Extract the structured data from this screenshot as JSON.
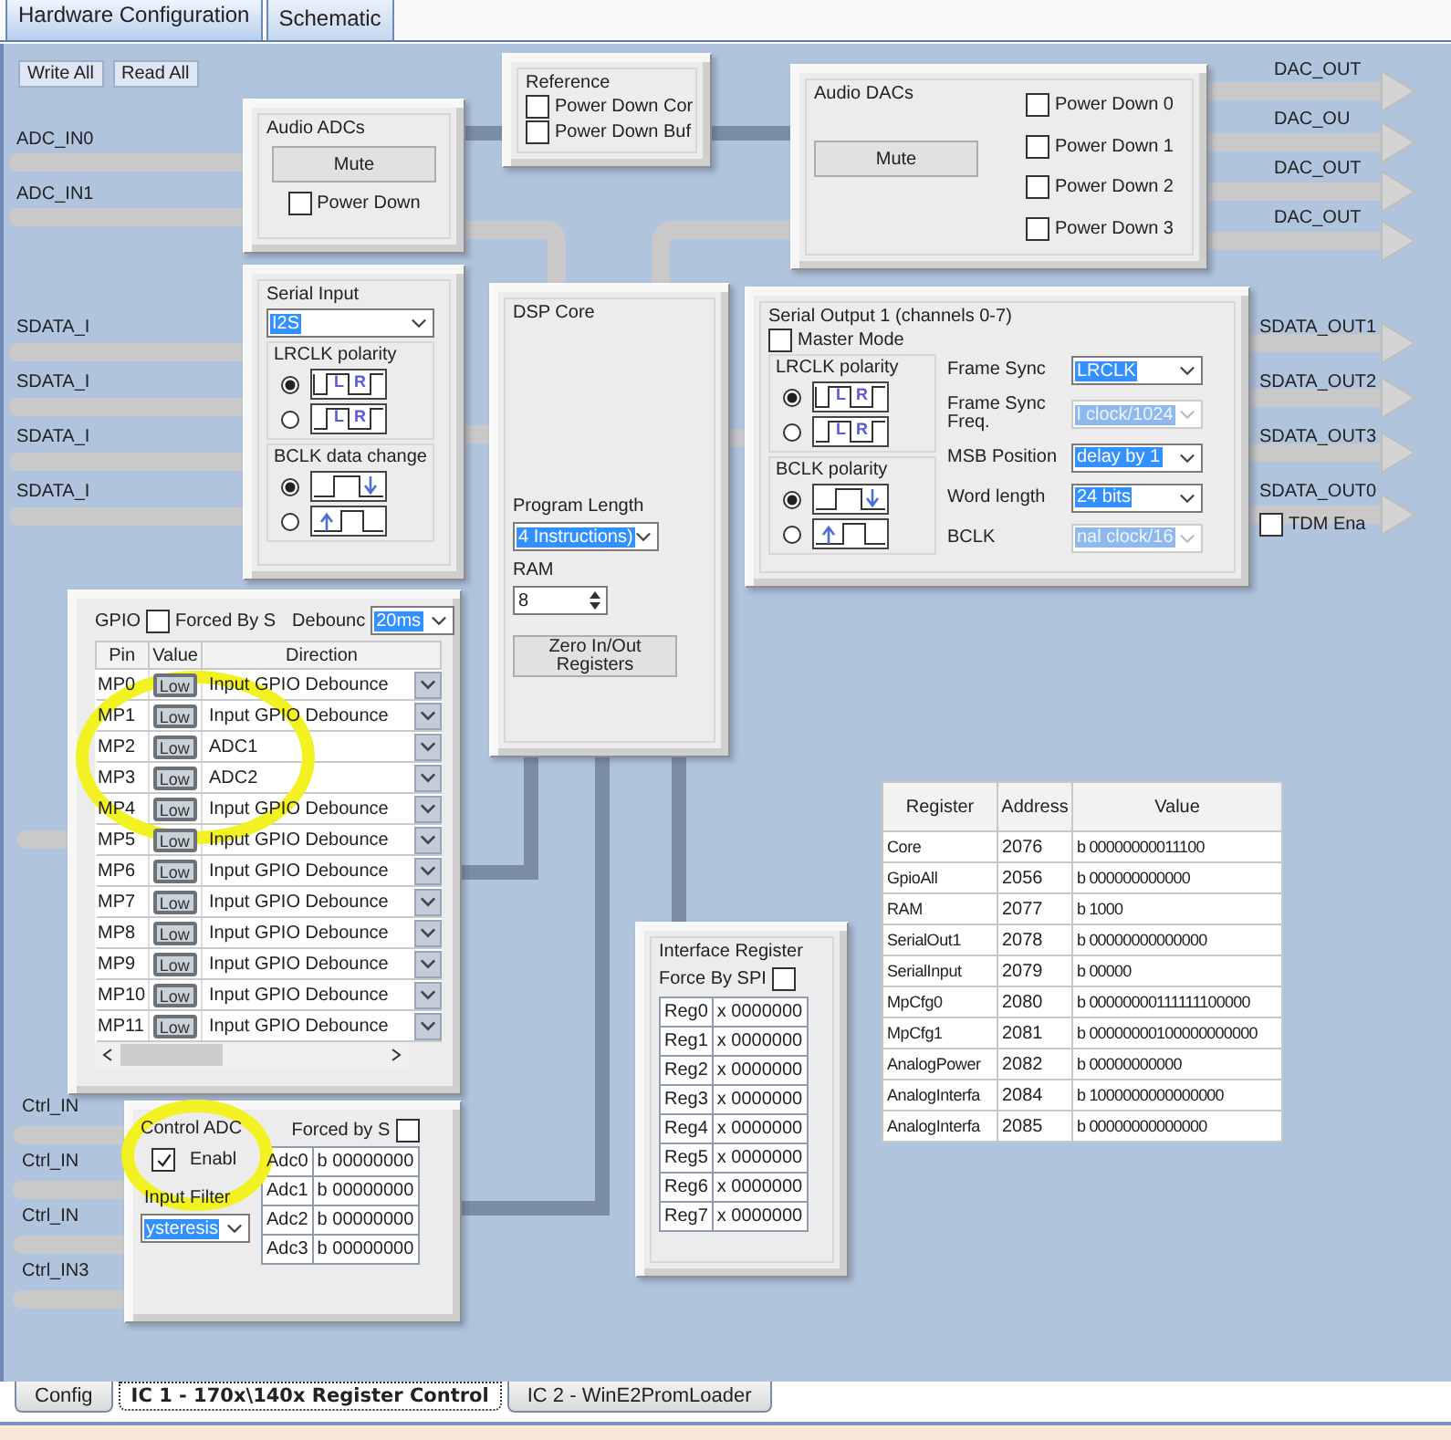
{
  "top_tabs": [
    {
      "label": "Hardware Configuration",
      "selected": true
    },
    {
      "label": "Schematic",
      "selected": false
    }
  ],
  "toolbar_buttons": [
    "Write All",
    "Read All"
  ],
  "adc_inputs": [
    "ADC_IN0",
    "ADC_IN1"
  ],
  "sdata_inputs": [
    "SDATA_I",
    "SDATA_I",
    "SDATA_I",
    "SDATA_I"
  ],
  "audio_adcs": {
    "title": "Audio ADCs",
    "mute": "Mute",
    "power_down": {
      "label": "Power Down",
      "checked": false
    }
  },
  "reference": {
    "title": "Reference",
    "options": [
      {
        "label": "Power Down Cor",
        "checked": false
      },
      {
        "label": "Power Down Buf",
        "checked": false
      }
    ]
  },
  "audio_dacs": {
    "title": "Audio DACs",
    "mute": "Mute",
    "options": [
      {
        "label": "Power Down 0",
        "checked": false
      },
      {
        "label": "Power Down 1",
        "checked": false
      },
      {
        "label": "Power Down 2",
        "checked": false
      },
      {
        "label": "Power Down 3",
        "checked": false
      }
    ]
  },
  "dac_outputs": [
    "DAC_OUT",
    "DAC_OU",
    "DAC_OUT",
    "DAC_OUT"
  ],
  "serial_input": {
    "title": "Serial Input",
    "format": "I2S",
    "lrclk": {
      "title": "LRCLK polarity",
      "options": [
        {
          "selected": true,
          "kind": "lr",
          "marks": [
            "L",
            "R"
          ]
        },
        {
          "selected": false,
          "kind": "lr-inverted",
          "marks": [
            "L",
            "R"
          ]
        }
      ]
    },
    "bclk": {
      "title": "BCLK data change",
      "options": [
        {
          "selected": true,
          "kind": "falling"
        },
        {
          "selected": false,
          "kind": "rising"
        }
      ]
    }
  },
  "dsp_core": {
    "title": "DSP Core",
    "program_length_label": "Program Length",
    "program_length": "4 Instructions)",
    "ram_label": "RAM",
    "ram_value": "8",
    "zero_button": "Zero In/Out Registers"
  },
  "serial_output": {
    "title": "Serial Output 1 (channels 0-7)",
    "master_mode": {
      "label": "Master Mode",
      "checked": false
    },
    "lrclk": {
      "title": "LRCLK polarity",
      "options": [
        {
          "selected": true,
          "kind": "lr",
          "marks": [
            "L",
            "R"
          ]
        },
        {
          "selected": false,
          "kind": "lr-inverted",
          "marks": [
            "L",
            "R"
          ]
        }
      ]
    },
    "bclk": {
      "title": "BCLK polarity",
      "options": [
        {
          "selected": true,
          "kind": "falling"
        },
        {
          "selected": false,
          "kind": "rising"
        }
      ]
    },
    "fields": [
      {
        "label": "Frame Sync",
        "value": "LRCLK",
        "disabled": false
      },
      {
        "label": "Frame Sync Freq.",
        "value": "l clock/1024",
        "disabled": true
      },
      {
        "label": "MSB Position",
        "value": "delay by 1",
        "disabled": false
      },
      {
        "label": "Word length",
        "value": "24 bits",
        "disabled": false
      },
      {
        "label": "BCLK",
        "value": "nal clock/16",
        "disabled": true
      }
    ]
  },
  "sdata_outputs": [
    "SDATA_OUT1",
    "SDATA_OUT2",
    "SDATA_OUT3",
    "SDATA_OUT0"
  ],
  "tdm": {
    "label": "TDM Ena",
    "checked": false
  },
  "gpio": {
    "title": "GPIO",
    "forced": {
      "label": "Forced By S",
      "checked": false
    },
    "debounce_label": "Debounc",
    "debounce": "20ms",
    "columns": [
      "Pin",
      "Value",
      "Direction"
    ],
    "rows": [
      {
        "pin": "MP0",
        "value": "Low",
        "direction": "Input  GPIO Debounce"
      },
      {
        "pin": "MP1",
        "value": "Low",
        "direction": "Input  GPIO Debounce"
      },
      {
        "pin": "MP2",
        "value": "Low",
        "direction": "ADC1"
      },
      {
        "pin": "MP3",
        "value": "Low",
        "direction": "ADC2"
      },
      {
        "pin": "MP4",
        "value": "Low",
        "direction": "Input  GPIO Debounce"
      },
      {
        "pin": "MP5",
        "value": "Low",
        "direction": "Input  GPIO Debounce"
      },
      {
        "pin": "MP6",
        "value": "Low",
        "direction": "Input  GPIO Debounce"
      },
      {
        "pin": "MP7",
        "value": "Low",
        "direction": "Input  GPIO Debounce"
      },
      {
        "pin": "MP8",
        "value": "Low",
        "direction": "Input  GPIO Debounce"
      },
      {
        "pin": "MP9",
        "value": "Low",
        "direction": "Input  GPIO Debounce"
      },
      {
        "pin": "MP10",
        "value": "Low",
        "direction": "Input  GPIO Debounce"
      },
      {
        "pin": "MP11",
        "value": "Low",
        "direction": "Input  GPIO Debounce"
      }
    ]
  },
  "interface_register": {
    "title": "Interface Register",
    "force": {
      "label": "Force By SPI",
      "checked": false
    },
    "rows": [
      {
        "name": "Reg0",
        "value": "x 0000000"
      },
      {
        "name": "Reg1",
        "value": "x 0000000"
      },
      {
        "name": "Reg2",
        "value": "x 0000000"
      },
      {
        "name": "Reg3",
        "value": "x 0000000"
      },
      {
        "name": "Reg4",
        "value": "x 0000000"
      },
      {
        "name": "Reg5",
        "value": "x 0000000"
      },
      {
        "name": "Reg6",
        "value": "x 0000000"
      },
      {
        "name": "Reg7",
        "value": "x 0000000"
      }
    ]
  },
  "register_table": {
    "columns": [
      "Register",
      "Address",
      "Value"
    ],
    "rows": [
      {
        "register": "Core",
        "address": "2076",
        "value": "b 00000000011100"
      },
      {
        "register": "GpioAll",
        "address": "2056",
        "value": "b 000000000000"
      },
      {
        "register": "RAM",
        "address": "2077",
        "value": "b 1000"
      },
      {
        "register": "SerialOut1",
        "address": "2078",
        "value": "b 00000000000000"
      },
      {
        "register": "SerialInput",
        "address": "2079",
        "value": "b 00000"
      },
      {
        "register": "MpCfg0",
        "address": "2080",
        "value": "b 00000000111111100000"
      },
      {
        "register": "MpCfg1",
        "address": "2081",
        "value": "b 00000000100000000000"
      },
      {
        "register": "AnalogPower",
        "address": "2082",
        "value": "b 00000000000"
      },
      {
        "register": "AnalogInterfa",
        "address": "2084",
        "value": "b 1000000000000000"
      },
      {
        "register": "AnalogInterfa",
        "address": "2085",
        "value": "b 00000000000000"
      }
    ]
  },
  "ctrl_inputs": [
    "Ctrl_IN",
    "Ctrl_IN",
    "Ctrl_IN",
    "Ctrl_IN3"
  ],
  "control_adc": {
    "title": "Control ADC",
    "enable": {
      "label": "Enabl",
      "checked": true
    },
    "forced": {
      "label": "Forced by S",
      "checked": false
    },
    "filter_label": "Input Filter",
    "filter": "ysteresis",
    "rows": [
      {
        "name": "Adc0",
        "value": "b 00000000"
      },
      {
        "name": "Adc1",
        "value": "b 00000000"
      },
      {
        "name": "Adc2",
        "value": "b 00000000"
      },
      {
        "name": "Adc3",
        "value": "b 00000000"
      }
    ]
  },
  "bottom_tabs": [
    {
      "label": "Config",
      "selected": false
    },
    {
      "label": "IC 1 - 170x\\140x Register Control",
      "selected": true
    },
    {
      "label": "IC 2 - WinE2PromLoader",
      "selected": false
    }
  ],
  "highlights": [
    {
      "kind": "ellipse"
    },
    {
      "kind": "ellipse"
    }
  ]
}
